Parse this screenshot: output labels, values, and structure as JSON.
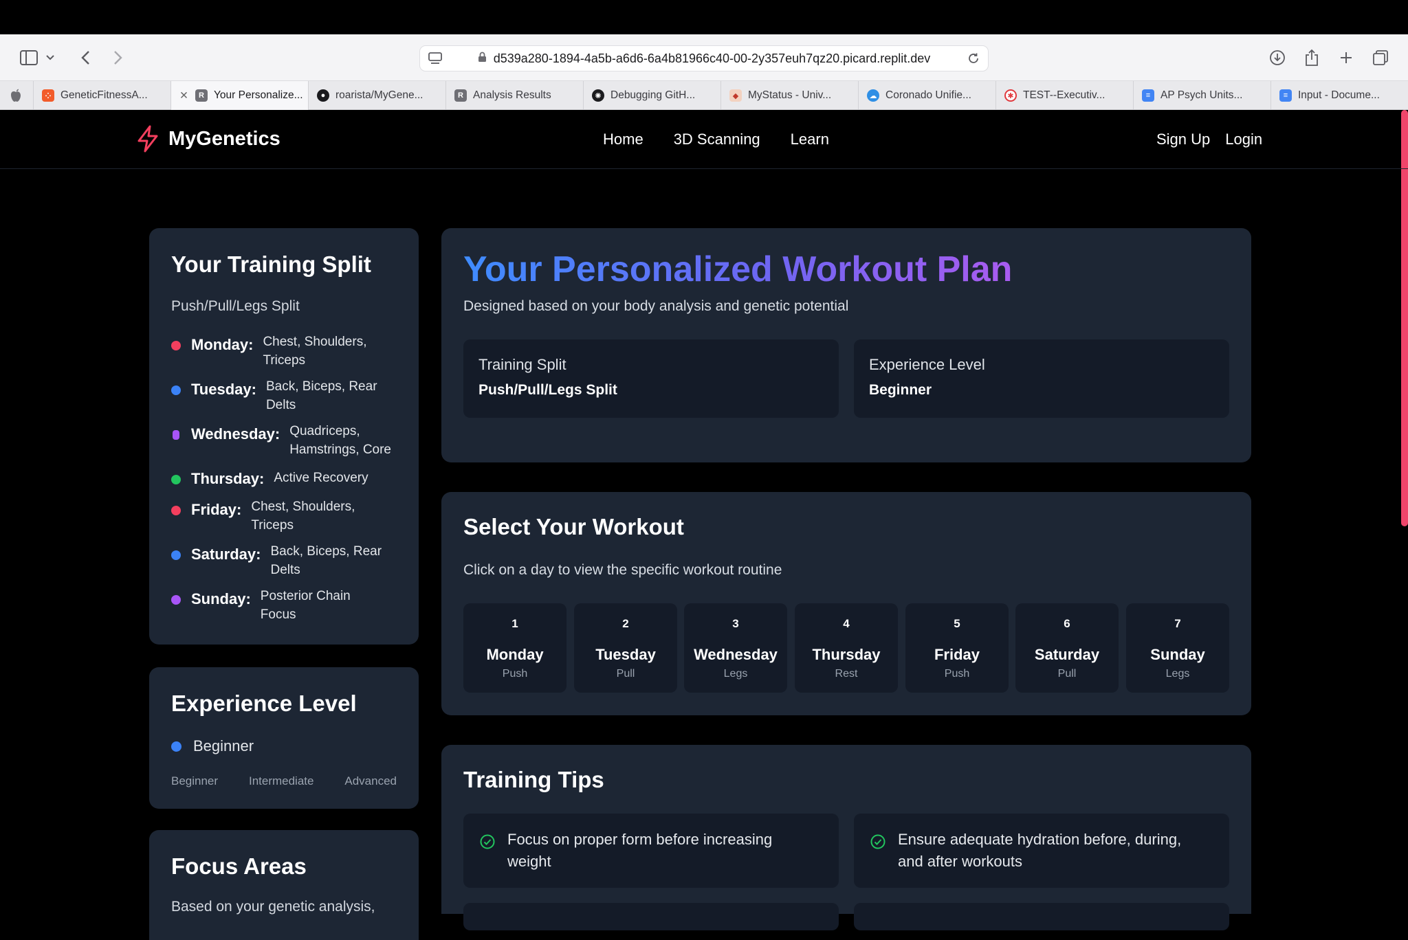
{
  "browser": {
    "url": "d539a280-1894-4a5b-a6d6-6a4b81966c40-00-2y357euh7qz20.picard.replit.dev",
    "tabs": [
      {
        "label": "GeneticFitnessA...",
        "active": false
      },
      {
        "label": "Your Personalize...",
        "active": true
      },
      {
        "label": "roarista/MyGene...",
        "active": false
      },
      {
        "label": "Analysis Results",
        "active": false
      },
      {
        "label": "Debugging GitH...",
        "active": false
      },
      {
        "label": "MyStatus - Univ...",
        "active": false
      },
      {
        "label": "Coronado Unifie...",
        "active": false
      },
      {
        "label": "TEST--Executiv...",
        "active": false
      },
      {
        "label": "AP Psych Units...",
        "active": false
      },
      {
        "label": "Input - Docume...",
        "active": false
      }
    ]
  },
  "nav": {
    "brand": "MyGenetics",
    "links": [
      "Home",
      "3D Scanning",
      "Learn"
    ],
    "signup": "Sign Up",
    "login": "Login"
  },
  "split": {
    "title": "Your Training Split",
    "subtitle": "Push/Pull/Legs Split",
    "days": [
      {
        "day": "Monday:",
        "desc": "Chest, Shoulders, Triceps",
        "color": "#f43f5e"
      },
      {
        "day": "Tuesday:",
        "desc": "Back, Biceps, Rear Delts",
        "color": "#3b82f6"
      },
      {
        "day": "Wednesday:",
        "desc": "Quadriceps, Hamstrings, Core",
        "color": "#a855f7"
      },
      {
        "day": "Thursday:",
        "desc": "Active Recovery",
        "color": "#22c55e"
      },
      {
        "day": "Friday:",
        "desc": "Chest, Shoulders, Triceps",
        "color": "#f43f5e"
      },
      {
        "day": "Saturday:",
        "desc": "Back, Biceps, Rear Delts",
        "color": "#3b82f6"
      },
      {
        "day": "Sunday:",
        "desc": "Posterior Chain Focus",
        "color": "#a855f7"
      }
    ]
  },
  "experience": {
    "title": "Experience Level",
    "current": "Beginner",
    "levels": [
      "Beginner",
      "Intermediate",
      "Advanced"
    ]
  },
  "focus": {
    "title": "Focus Areas",
    "text": "Based on your genetic analysis,"
  },
  "plan": {
    "title": "Your Personalized Workout Plan",
    "subtitle": "Designed based on your body analysis and genetic potential",
    "split_label": "Training Split",
    "split_value": "Push/Pull/Legs Split",
    "level_label": "Experience Level",
    "level_value": "Beginner"
  },
  "select": {
    "title": "Select Your Workout",
    "subtitle": "Click on a day to view the specific workout routine",
    "days": [
      {
        "num": "1",
        "name": "Monday",
        "type": "Push"
      },
      {
        "num": "2",
        "name": "Tuesday",
        "type": "Pull"
      },
      {
        "num": "3",
        "name": "Wednesday",
        "type": "Legs"
      },
      {
        "num": "4",
        "name": "Thursday",
        "type": "Rest"
      },
      {
        "num": "5",
        "name": "Friday",
        "type": "Push"
      },
      {
        "num": "6",
        "name": "Saturday",
        "type": "Pull"
      },
      {
        "num": "7",
        "name": "Sunday",
        "type": "Legs"
      }
    ]
  },
  "tips": {
    "title": "Training Tips",
    "items": [
      "Focus on proper form before increasing weight",
      "Ensure adequate hydration before, during, and after workouts"
    ]
  },
  "colors": {
    "accent": "#f43f5e",
    "card": "#1d2634",
    "inner": "#141b28",
    "check": "#22c55e"
  }
}
